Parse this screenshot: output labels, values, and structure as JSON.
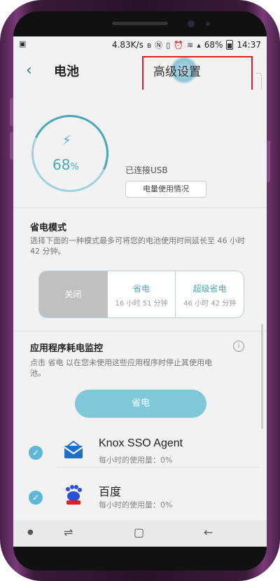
{
  "status_bar": {
    "speed": "4.83K/s",
    "battery": "68%",
    "time": "14:37",
    "icons": [
      "bluetooth-icon",
      "nfc-icon",
      "vibrate-icon",
      "alarm-icon",
      "wifi-icon",
      "signal-icon",
      "battery-icon"
    ]
  },
  "appbar": {
    "title": "电池",
    "advanced_label": "高级设置"
  },
  "battery": {
    "percent": "68",
    "percent_unit": "%",
    "connection": "已连接USB",
    "usage_button": "电量使用情况"
  },
  "power_saving": {
    "title": "省电模式",
    "description": "选择下面的一种模式最多可将您的电池使用时间延长至 46 小时 42 分钟。",
    "modes": [
      {
        "label": "关闭",
        "sub": ""
      },
      {
        "label": "省电",
        "sub": "16 小时 51 分钟"
      },
      {
        "label": "超级省电",
        "sub": "46 小时 42 分钟"
      }
    ],
    "selected_mode": "关闭"
  },
  "app_monitor": {
    "title": "应用程序耗电监控",
    "description": "点击 省电 以在您未使用这些应用程序时停止其使用电池。",
    "save_button": "省电",
    "apps": [
      {
        "name": "Knox SSO Agent",
        "usage": "每小时的使用量：0%",
        "checked": true,
        "icon": "mail-icon"
      },
      {
        "name": "百度",
        "usage": "每小时的使用量：0%",
        "checked": true,
        "icon": "baidu-icon"
      }
    ]
  },
  "colors": {
    "accent": "#4aa8b8",
    "button": "#7ec8d8",
    "highlight_box": "#e02020"
  }
}
